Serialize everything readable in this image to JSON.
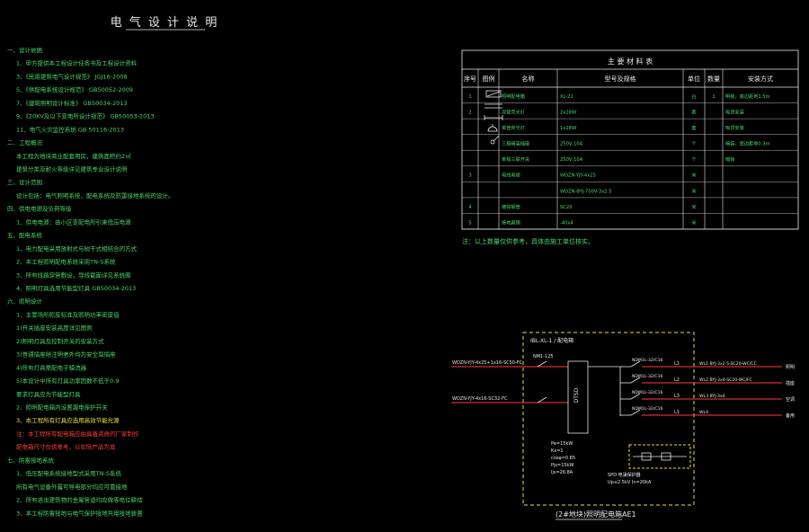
{
  "title": "电 气 设 计 说 明",
  "notes": [
    {
      "t": "一、设计依据",
      "c": "g"
    },
    {
      "t": "1、甲方提供本工程设计任务书及工程设计资料",
      "c": "g"
    },
    {
      "t": "3、《民用建筑电气设计规范》  JGJ16-2008",
      "c": "g"
    },
    {
      "t": "5、《供配电系统设计规范》  GB50052-2009",
      "c": "g"
    },
    {
      "t": "7、《建筑照明设计标准》  GB50034-2013",
      "c": "g"
    },
    {
      "t": "9、《20KV及以下变电所设计规范》  GB50053-2013",
      "c": "g"
    },
    {
      "t": "11、电气火灾监控系统  GB 50116-2013",
      "c": "g"
    },
    {
      "t": "二、工程概况",
      "c": "g"
    },
    {
      "t": "本工程为地块商业配套用房，建筑面积约2㎡",
      "c": "g"
    },
    {
      "t": "建筑分类及耐火等级详见建筑专业设计说明",
      "c": "g"
    },
    {
      "t": "三、设计范围",
      "c": "g"
    },
    {
      "t": "设计包括：电气照明系统、配电系统及防雷接地系统的设计。",
      "c": "g"
    },
    {
      "t": "四、供电电源及负荷等级",
      "c": "g"
    },
    {
      "t": "1、供电电源：由小区变配电所引来低压电源",
      "c": "g"
    },
    {
      "t": "五、配电系统",
      "c": "g"
    },
    {
      "t": "1、电力配电采用放射式与树干式相结合的方式",
      "c": "g"
    },
    {
      "t": "2、本工程照明配电系统采用TN-S系统",
      "c": "g"
    },
    {
      "t": "3、所有线路穿管敷设，导线截面详见系统图",
      "c": "g"
    },
    {
      "t": "4、照明灯具选用节能型灯具  GB50034-2013",
      "c": "g"
    },
    {
      "t": "六、照明设计",
      "c": "g"
    },
    {
      "t": "1、主要场所照度标准及照明功率密度值",
      "c": "g"
    },
    {
      "t": "1)开关插座安装高度详见图例",
      "c": "g"
    },
    {
      "t": "2)照明灯具及控制开关的安装方式",
      "c": "g"
    },
    {
      "t": "3)普通插座除注明者外均为安全型插座",
      "c": "g"
    },
    {
      "t": "4)所有灯具需配电子镇流器",
      "c": "g"
    },
    {
      "t": "5)本设计中所有灯具功率因数不低于0.9",
      "c": "g"
    },
    {
      "t": "要求灯具应为节能型灯具",
      "c": "g"
    },
    {
      "t": "2、照明配电箱内设置漏电保护开关",
      "c": "g"
    },
    {
      "t": "3、本工程所有灯具应选用高效节能光源",
      "c": "y"
    },
    {
      "t": "注：本工程所有配电箱应由具备资质的厂家制作",
      "c": "r"
    },
    {
      "t": "配电箱尺寸仅供参考，以实际产品为准",
      "c": "r"
    },
    {
      "t": "七、防雷接地系统",
      "c": "g"
    },
    {
      "t": "1、低压配电系统接地型式采用TN-S系统",
      "c": "g"
    },
    {
      "t": "所有电气设备外露可导电部分均应可靠接地",
      "c": "g"
    },
    {
      "t": "2、所有进出建筑物的金属管道均应做等电位联结",
      "c": "g"
    },
    {
      "t": "3、本工程防雷接地与电气保护接地共用接地装置",
      "c": "g"
    }
  ],
  "table": {
    "title": "主 要 材 料 表",
    "headers": [
      "序号",
      "图例",
      "名称",
      "型号及规格",
      "单位",
      "数量",
      "安装方式"
    ],
    "rows": [
      [
        "1",
        "",
        "照明配电箱",
        "XL-21",
        "台",
        "1",
        "明装，底边距地1.5m"
      ],
      [
        "2",
        "",
        "双管荧光灯",
        "2x28W",
        "套",
        "",
        "吸顶安装"
      ],
      [
        "",
        "",
        "单管荧光灯",
        "1x28W",
        "套",
        "",
        "吸顶安装"
      ],
      [
        "",
        "",
        "三极暗装插座",
        "250V,10A",
        "个",
        "",
        "暗装，底边距地0.3m"
      ],
      [
        "",
        "",
        "单极三联开关",
        "250V,10A",
        "个",
        "",
        "暗装"
      ],
      [
        "3",
        "",
        "电线电缆",
        "WDZN-YJY-4x25",
        "米",
        "",
        ""
      ],
      [
        "",
        "",
        "",
        "WDZN-BYJ-750V-3x2.5",
        "米",
        "",
        ""
      ],
      [
        "4",
        "",
        "镀锌钢管",
        "SC20",
        "米",
        "",
        ""
      ],
      [
        "5",
        "",
        "接地扁钢",
        "-40x4",
        "米",
        "",
        ""
      ]
    ],
    "note": "注：以上数量仅供参考，具体由施工单位核实。"
  },
  "diagram": {
    "incoming": [
      "WDZN-YJY-4x25+1x16-SC50-FC",
      "WDZN-YJY-4x16-SC32-FC"
    ],
    "main_breaker": "NM1-125",
    "box_label": "IBL-XL-1 / 配电箱",
    "meter_label": "DTSD",
    "outgoing": [
      {
        "breaker": "NDM1L-32/C16",
        "phase": "L1",
        "cable": "WL1 BYJ-3x2.5-SC20-WC/CC",
        "load": "照明"
      },
      {
        "breaker": "NDM1L-32/C16",
        "phase": "L2",
        "cable": "WL2 BYJ-3x4-SC20-WC/FC",
        "load": "插座"
      },
      {
        "breaker": "NDM1L-32/C16",
        "phase": "L3",
        "cable": "WL3 BYJ-3x4",
        "load": "空调"
      },
      {
        "breaker": "NDM1L-32/C16",
        "phase": "L1",
        "cable": "WL4",
        "load": "备用"
      }
    ],
    "params": [
      "Pe=15kW",
      "Kx=1",
      "cosφ=0.85",
      "Pjs=15kW",
      "Ijs=26.8A"
    ],
    "spd_label": "SPD 电涌保护器",
    "spd_note": "Up≤2.5kV In=20kA",
    "caption": "(2#地块)照明配电箱AE1"
  }
}
